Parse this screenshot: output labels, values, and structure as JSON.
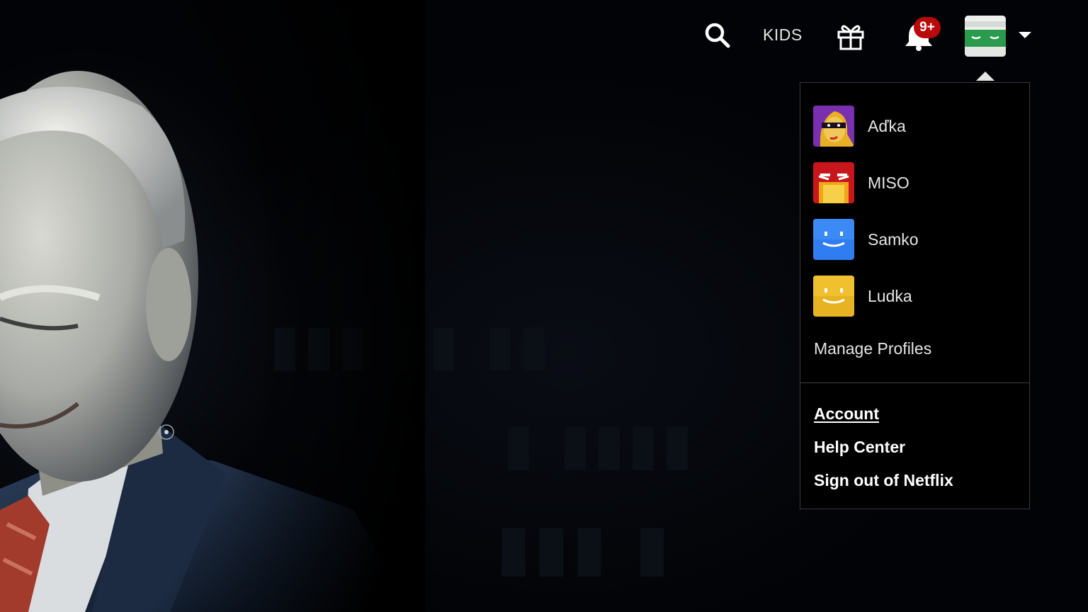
{
  "header": {
    "kids_label": "KIDS",
    "notification_badge": "9+",
    "icons": [
      "search-icon",
      "gift-icon",
      "bell-icon",
      "profile-avatar",
      "caret-down-icon"
    ]
  },
  "profile_menu": {
    "profiles": [
      {
        "name": "Aďka",
        "icon": "avatar-masked-woman",
        "color": "#6a2fa0"
      },
      {
        "name": "MISO",
        "icon": "avatar-red-face",
        "color": "#c8161d"
      },
      {
        "name": "Samko",
        "icon": "avatar-blue-smile",
        "color": "#2f7df0"
      },
      {
        "name": "Ludka",
        "icon": "avatar-yellow-smile",
        "color": "#f0c02f"
      }
    ],
    "manage_profiles": "Manage Profiles",
    "links": {
      "account": "Account",
      "help_center": "Help Center",
      "sign_out": "Sign out of Netflix"
    }
  },
  "colors": {
    "badge": "#b9090b",
    "menu_background": "#000000",
    "text": "#e5e5e5"
  }
}
